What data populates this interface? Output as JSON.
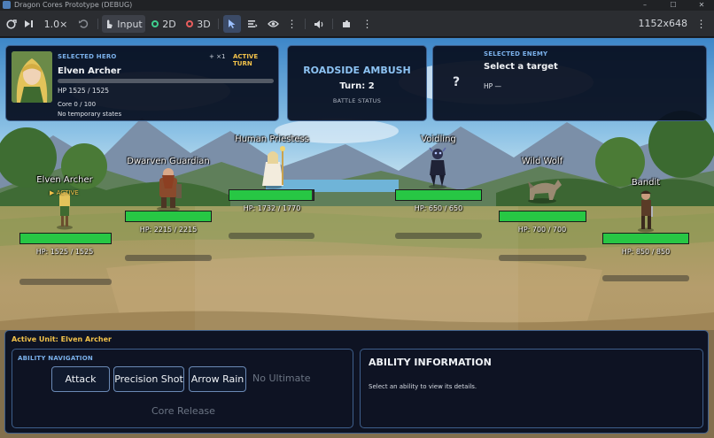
{
  "window": {
    "title": "Dragon Cores Prototype (DEBUG)",
    "controls": [
      "–",
      "☐",
      "✕"
    ]
  },
  "toolbar": {
    "speed": "1.0×",
    "input_label": "Input",
    "mode_2d": "2D",
    "mode_3d": "3D",
    "resolution": "1152x648",
    "colors": {
      "mode_2d": "#3fcf8e",
      "mode_3d": "#e85d5d"
    }
  },
  "hero_panel": {
    "caption": "SELECTED HERO",
    "plus": "+ ×1",
    "active_turn": "ACTIVE TURN",
    "name": "Elven Archer",
    "hp": "HP 1525 / 1525",
    "core": "Core 0 / 100",
    "states": "No temporary states"
  },
  "battle_panel": {
    "title": "ROADSIDE AMBUSH",
    "turn": "Turn: 2",
    "status": "BATTLE STATUS"
  },
  "enemy_panel": {
    "caption": "SELECTED ENEMY",
    "placeholder": "?",
    "name": "Select a target",
    "hp": "HP —"
  },
  "units": [
    {
      "name": "Elven Archer",
      "hp_text": "HP: 1525 / 1525",
      "hp": 1525,
      "max_hp": 1525,
      "active_label": "▶ ACTIVE"
    },
    {
      "name": "Dwarven Guardian",
      "hp_text": "HP: 2215 / 2215",
      "hp": 2215,
      "max_hp": 2215
    },
    {
      "name": "Human Priestess",
      "hp_text": "HP: 1732 / 1770",
      "hp": 1732,
      "max_hp": 1770
    },
    {
      "name": "Voidling",
      "hp_text": "HP: 650 / 650",
      "hp": 650,
      "max_hp": 650
    },
    {
      "name": "Wild Wolf",
      "hp_text": "HP: 700 / 700",
      "hp": 700,
      "max_hp": 700
    },
    {
      "name": "Bandit",
      "hp_text": "HP: 850 / 850",
      "hp": 850,
      "max_hp": 850
    }
  ],
  "bottom": {
    "active_unit": "Active Unit: Elven Archer",
    "nav_caption": "ABILITY NAVIGATION",
    "abilities": [
      "Attack",
      "Precision Shot",
      "Arrow Rain"
    ],
    "no_ultimate": "No Ultimate",
    "core_release": "Core Release",
    "info_title": "ABILITY INFORMATION",
    "info_hint": "Select an ability to view its details."
  }
}
